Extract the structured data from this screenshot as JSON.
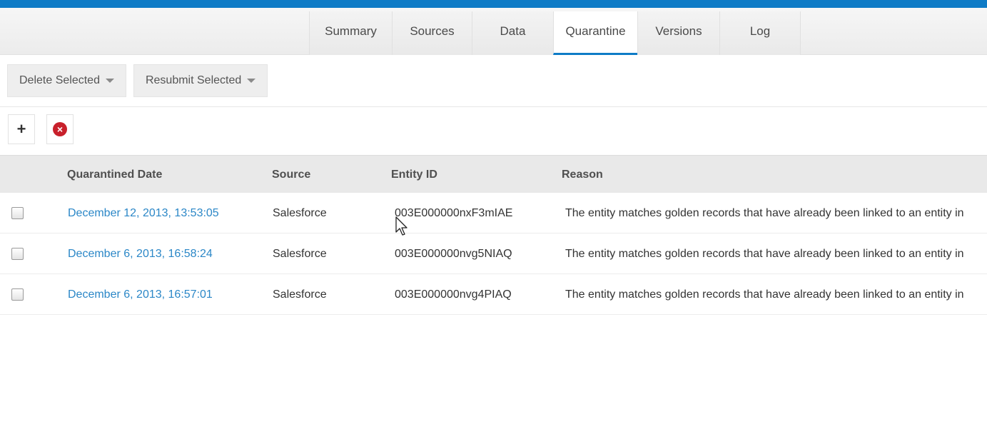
{
  "tabs": [
    {
      "label": "Summary",
      "active": false
    },
    {
      "label": "Sources",
      "active": false
    },
    {
      "label": "Data",
      "active": false
    },
    {
      "label": "Quarantine",
      "active": true
    },
    {
      "label": "Versions",
      "active": false
    },
    {
      "label": "Log",
      "active": false
    }
  ],
  "toolbar": {
    "delete_label": "Delete Selected",
    "resubmit_label": "Resubmit Selected",
    "add_icon": "plus-icon",
    "remove_icon": "x-circle-icon"
  },
  "table": {
    "columns": [
      "Quarantined Date",
      "Source",
      "Entity ID",
      "Reason"
    ],
    "rows": [
      {
        "date": "December 12, 2013, 13:53:05",
        "source": "Salesforce",
        "entity_id": "003E000000nxF3mIAE",
        "reason": "The entity matches golden records that have already been linked to an entity in"
      },
      {
        "date": "December 6, 2013, 16:58:24",
        "source": "Salesforce",
        "entity_id": "003E000000nvg5NIAQ",
        "reason": "The entity matches golden records that have already been linked to an entity in"
      },
      {
        "date": "December 6, 2013, 16:57:01",
        "source": "Salesforce",
        "entity_id": "003E000000nvg4PIAQ",
        "reason": "The entity matches golden records that have already been linked to an entity in"
      }
    ]
  },
  "colors": {
    "accent": "#0e7bc6",
    "link": "#2b87c7",
    "remove": "#c8202b"
  }
}
